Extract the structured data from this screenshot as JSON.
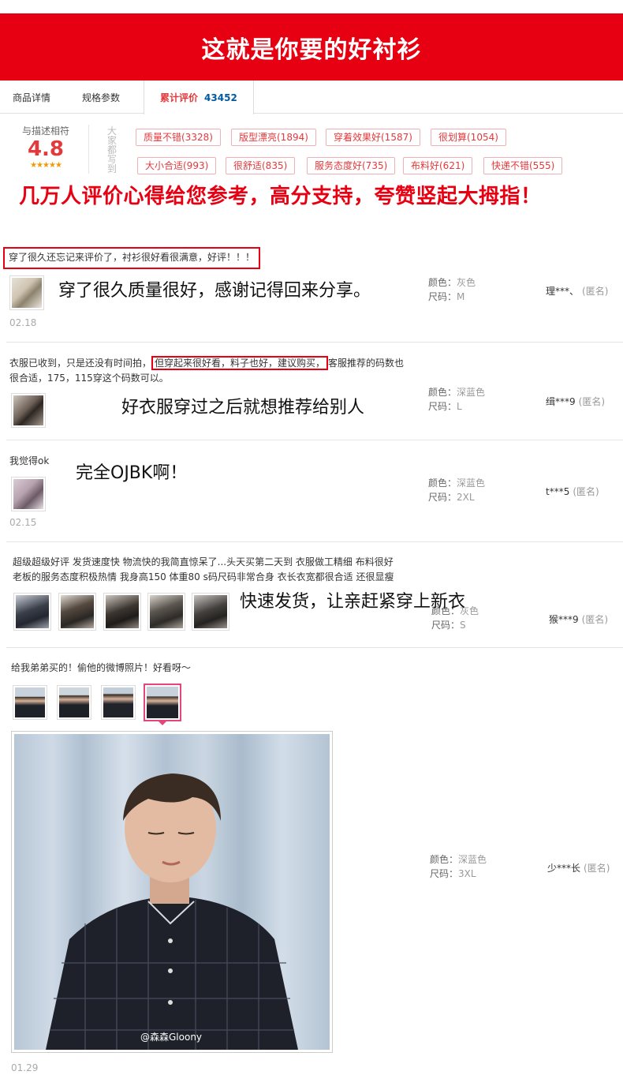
{
  "banner": {
    "title": "这就是你要的好衬衫"
  },
  "tabs": [
    {
      "label": "商品详情"
    },
    {
      "label": "规格参数"
    },
    {
      "label": "累计评价",
      "count": "43452"
    }
  ],
  "rating": {
    "label": "与描述相符",
    "score": "4.8",
    "stars": "★★★★★"
  },
  "tags_label": "大家都写到",
  "tags": [
    "质量不错(3328)",
    "版型漂亮(1894)",
    "穿着效果好(1587)",
    "很划算(1054)",
    "大小合适(993)",
    "很舒适(835)",
    "服务态度好(735)",
    "布料好(621)",
    "快递不错(555)"
  ],
  "headline": "几万人评价心得给您参考，高分支持，夸赞竖起大拇指！",
  "attr_labels": {
    "color": "颜色：",
    "size": "尺码："
  },
  "anon_label": "(匿名)",
  "reviews": [
    {
      "text": "穿了很久还忘记来评价了，衬衫很好看很满意，好评！！！",
      "caption": "穿了很久质量很好，感谢记得回来分享。",
      "date": "02.18",
      "color": "灰色",
      "size": "M",
      "user": "理***、"
    },
    {
      "text_line1_a": "衣服已收到，只是还没有时间拍，",
      "text_line1_b": "但穿起来很好看，料子也好，建议购买，",
      "text_line1_c": "客服推荐的码数也",
      "text_line2": "很合适，175，115穿这个码数可以。",
      "caption": "好衣服穿过之后就想推荐给别人",
      "color": "深蓝色",
      "size": "L",
      "user": "缉***9"
    },
    {
      "text": "我觉得ok",
      "caption": "完全OJBK啊！",
      "date": "02.15",
      "color": "深蓝色",
      "size": "2XL",
      "user": "t***5"
    },
    {
      "text_line1": "超级超级好评 发货速度快 物流快的我简直惊呆了...头天买第二天到 衣服做工精细 布料很好",
      "text_line2": "老板的服务态度积极热情 我身高150 体重80 s码尺码非常合身 衣长衣宽都很合适 还很显瘦",
      "caption": "快速发货，让亲赶紧穿上新衣",
      "color": "灰色",
      "size": "S",
      "user": "猴***9"
    },
    {
      "text": "给我弟弟买的！偷他的微博照片！好看呀～",
      "watermark": "@森森Gloony",
      "date": "01.29",
      "color": "深蓝色",
      "size": "3XL",
      "user": "少***长"
    }
  ]
}
